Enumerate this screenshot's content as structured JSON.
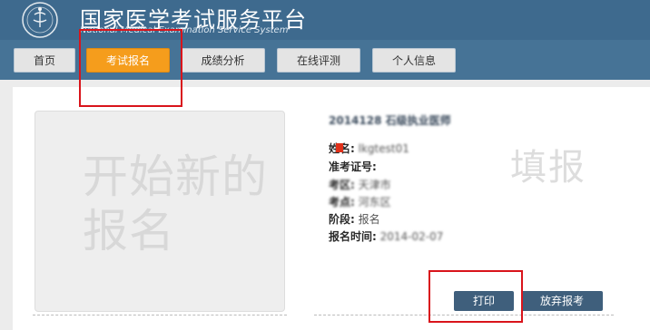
{
  "header": {
    "title": "国家医学考试服务平台",
    "subtitle": "National Medical Examination Service System"
  },
  "nav": {
    "items": [
      {
        "label": "首页"
      },
      {
        "label": "考试报名"
      },
      {
        "label": "成绩分析"
      },
      {
        "label": "在线评测"
      },
      {
        "label": "个人信息"
      }
    ],
    "active_index": 1
  },
  "new_card": {
    "label": "开始新的报名"
  },
  "exam": {
    "title": "2014128 石级执业医师",
    "rows": [
      {
        "label": "姓名:",
        "value": "lkgtest01"
      },
      {
        "label": "准考证号:",
        "value": ""
      },
      {
        "label": "考区:",
        "value": "天津市"
      },
      {
        "label": "考点:",
        "value": "河东区"
      },
      {
        "label": "阶段:",
        "value": "报名"
      },
      {
        "label": "报名时间:",
        "value": "2014-02-07"
      }
    ]
  },
  "watermark": "填报",
  "actions": {
    "print_label": "打印",
    "abandon_label": "放弃报考"
  },
  "colors": {
    "header_bg": "#3e6a8e",
    "active_tab": "#f59d1c",
    "action_button": "#3f5f7c",
    "highlight_box": "#d9141b"
  }
}
